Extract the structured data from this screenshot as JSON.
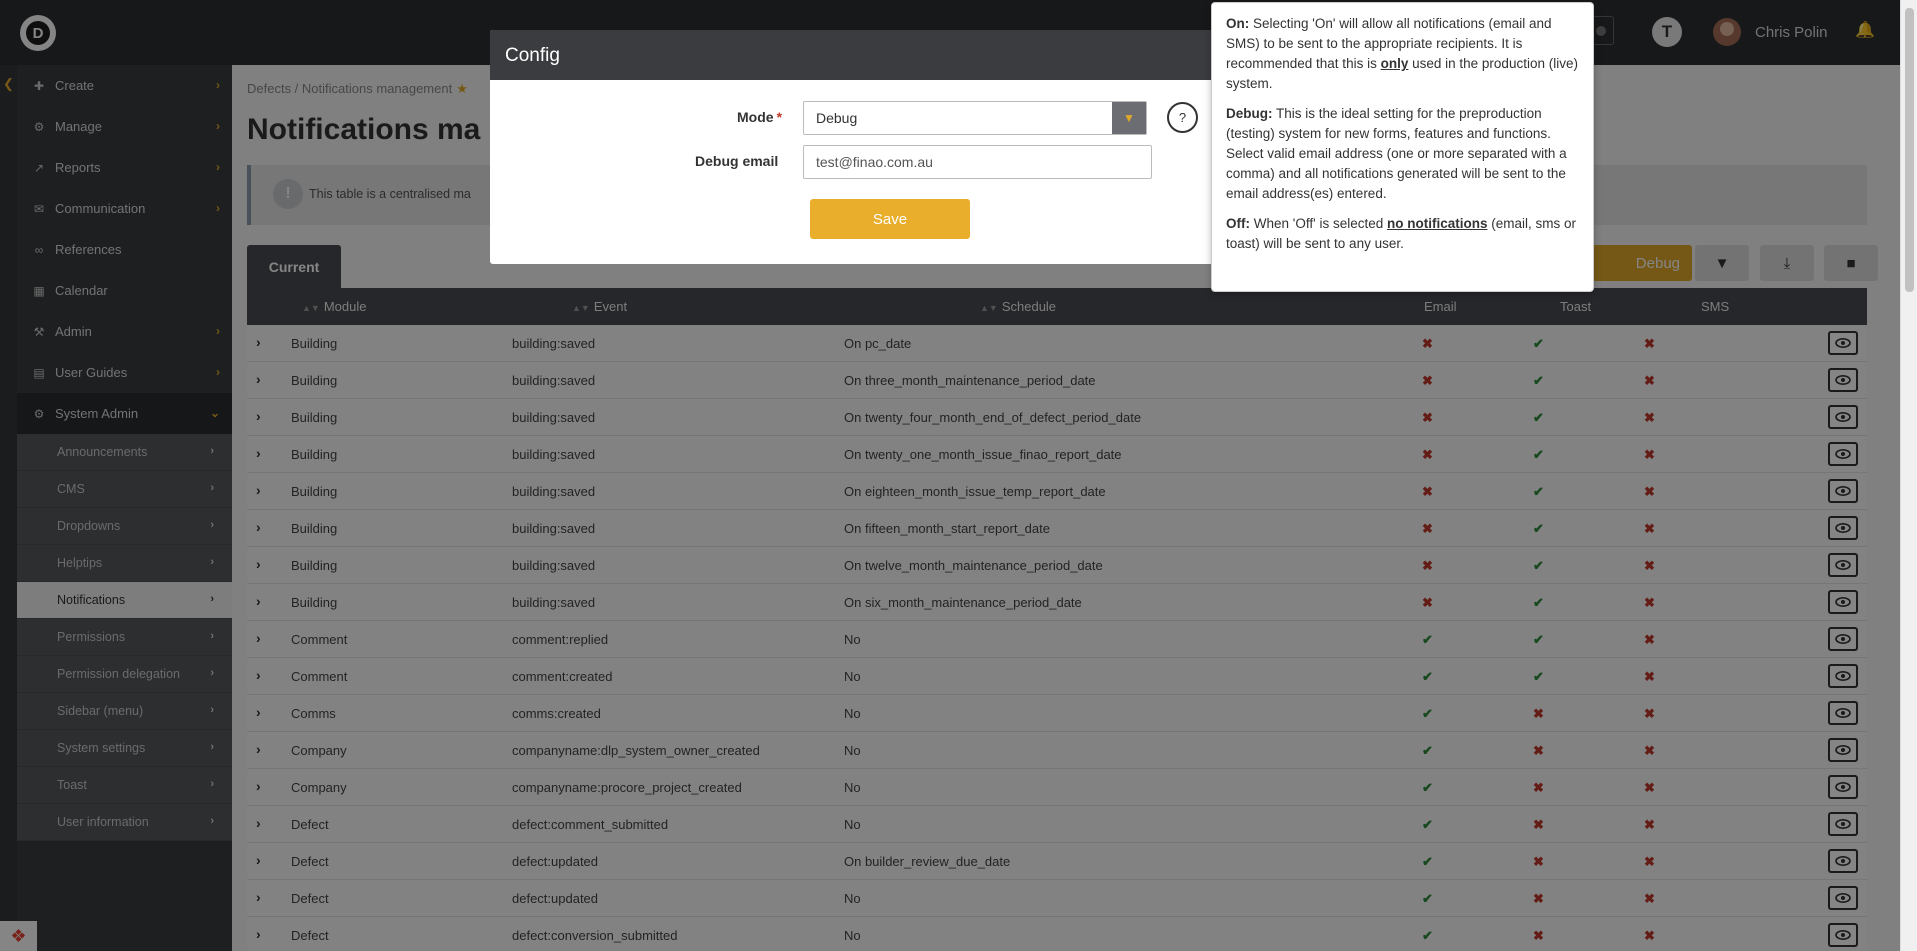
{
  "topbar": {
    "logo_letter": "D",
    "tenant_initial": "T",
    "user_name": "Chris Polin"
  },
  "sidebar": {
    "items": [
      {
        "label": "Create",
        "icon": "plus-icon",
        "has_chevron": true
      },
      {
        "label": "Manage",
        "icon": "gear-icon",
        "has_chevron": true
      },
      {
        "label": "Reports",
        "icon": "chart-icon",
        "has_chevron": true
      },
      {
        "label": "Communication",
        "icon": "chat-icon",
        "has_chevron": true
      },
      {
        "label": "References",
        "icon": "link-icon",
        "has_chevron": false
      },
      {
        "label": "Calendar",
        "icon": "calendar-icon",
        "has_chevron": false
      },
      {
        "label": "Admin",
        "icon": "wrench-icon",
        "has_chevron": true
      },
      {
        "label": "User Guides",
        "icon": "book-icon",
        "has_chevron": true
      },
      {
        "label": "System Admin",
        "icon": "gears-icon",
        "has_chevron": true
      }
    ],
    "submenu": [
      "Announcements",
      "CMS",
      "Dropdowns",
      "Helptips",
      "Notifications",
      "Permissions",
      "Permission delegation",
      "Sidebar (menu)",
      "System settings",
      "Toast",
      "User information"
    ],
    "active_submenu": "Notifications"
  },
  "main": {
    "breadcrumb": "Defects / Notifications management",
    "title": "Notifications ma",
    "info_text": "This table is a centralised ma",
    "tab_label": "Current",
    "debug_button": "Debug",
    "columns": [
      "Module",
      "Event",
      "Schedule",
      "Email",
      "Toast",
      "SMS"
    ],
    "rows": [
      {
        "module": "Building",
        "event": "building:saved",
        "schedule": "On pc_date",
        "email": false,
        "toast": true,
        "sms": false
      },
      {
        "module": "Building",
        "event": "building:saved",
        "schedule": "On three_month_maintenance_period_date",
        "email": false,
        "toast": true,
        "sms": false
      },
      {
        "module": "Building",
        "event": "building:saved",
        "schedule": "On twenty_four_month_end_of_defect_period_date",
        "email": false,
        "toast": true,
        "sms": false
      },
      {
        "module": "Building",
        "event": "building:saved",
        "schedule": "On twenty_one_month_issue_finao_report_date",
        "email": false,
        "toast": true,
        "sms": false
      },
      {
        "module": "Building",
        "event": "building:saved",
        "schedule": "On eighteen_month_issue_temp_report_date",
        "email": false,
        "toast": true,
        "sms": false
      },
      {
        "module": "Building",
        "event": "building:saved",
        "schedule": "On fifteen_month_start_report_date",
        "email": false,
        "toast": true,
        "sms": false
      },
      {
        "module": "Building",
        "event": "building:saved",
        "schedule": "On twelve_month_maintenance_period_date",
        "email": false,
        "toast": true,
        "sms": false
      },
      {
        "module": "Building",
        "event": "building:saved",
        "schedule": "On six_month_maintenance_period_date",
        "email": false,
        "toast": true,
        "sms": false
      },
      {
        "module": "Comment",
        "event": "comment:replied",
        "schedule": "No",
        "email": true,
        "toast": true,
        "sms": false
      },
      {
        "module": "Comment",
        "event": "comment:created",
        "schedule": "No",
        "email": true,
        "toast": true,
        "sms": false
      },
      {
        "module": "Comms",
        "event": "comms:created",
        "schedule": "No",
        "email": true,
        "toast": false,
        "sms": false
      },
      {
        "module": "Company",
        "event": "companyname:dlp_system_owner_created",
        "schedule": "No",
        "email": true,
        "toast": false,
        "sms": false
      },
      {
        "module": "Company",
        "event": "companyname:procore_project_created",
        "schedule": "No",
        "email": true,
        "toast": false,
        "sms": false
      },
      {
        "module": "Defect",
        "event": "defect:comment_submitted",
        "schedule": "No",
        "email": true,
        "toast": false,
        "sms": false
      },
      {
        "module": "Defect",
        "event": "defect:updated",
        "schedule": "On builder_review_due_date",
        "email": true,
        "toast": false,
        "sms": false
      },
      {
        "module": "Defect",
        "event": "defect:updated",
        "schedule": "No",
        "email": true,
        "toast": false,
        "sms": false
      },
      {
        "module": "Defect",
        "event": "defect:conversion_submitted",
        "schedule": "No",
        "email": true,
        "toast": false,
        "sms": false
      }
    ]
  },
  "modal": {
    "title": "Config",
    "mode_label": "Mode",
    "mode_value": "Debug",
    "help_label": "?",
    "email_label": "Debug email",
    "email_value": "test@finao.com.au",
    "save_label": "Save"
  },
  "popover": {
    "on_title": "On:",
    "on_text_1": "Selecting 'On' will allow all notifications (email and SMS) to be sent to the appropriate recipients. It is recommended that this is",
    "on_emph": "only",
    "on_text_2": "used in the production (live) system.",
    "debug_title": "Debug:",
    "debug_text": "This is the ideal setting for the preproduction (testing) system for new forms, features and functions. Select valid email address (one or more separated with a comma) and all notifications generated will be sent to the email address(es) entered.",
    "off_title": "Off:",
    "off_text_1": "When 'Off' is selected",
    "off_emph": "no notifications",
    "off_text_2": "(email, sms or toast) will be sent to any user."
  },
  "colors": {
    "accent": "#e0a92a",
    "dark": "#3a3c40",
    "cross": "#c0392b",
    "check": "#2e8b3a"
  }
}
